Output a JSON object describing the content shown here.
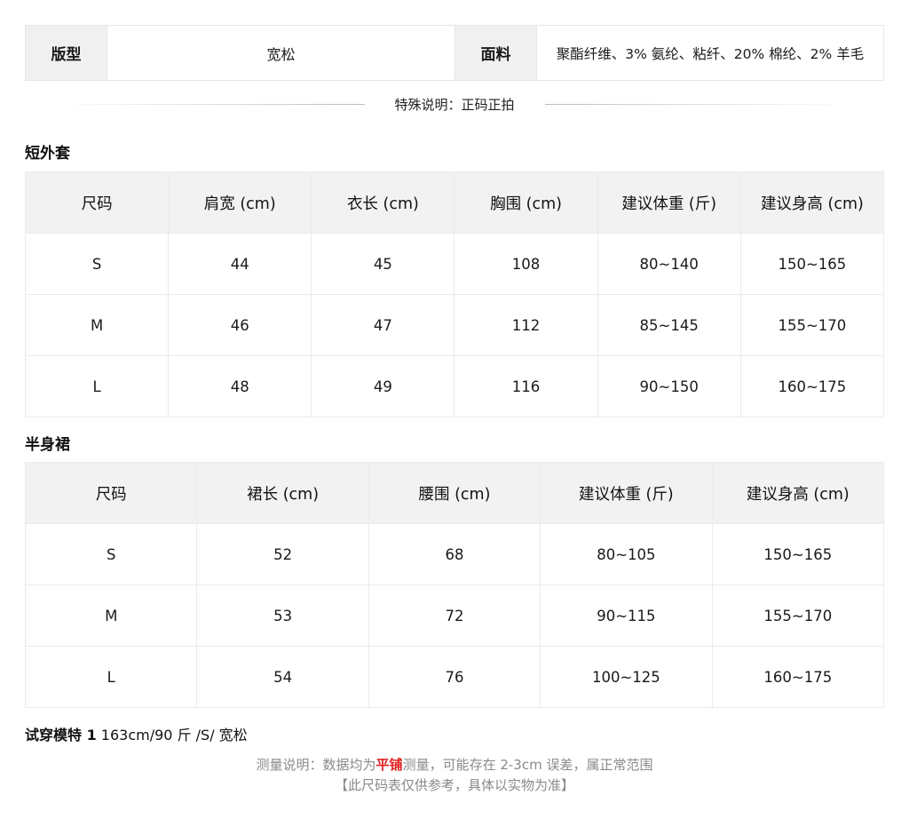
{
  "spec": {
    "style_label": "版型",
    "style_value": "宽松",
    "fabric_label": "面料",
    "fabric_value": "聚酯纤维、3% 氨纶、粘纤、20% 棉纶、2% 羊毛"
  },
  "special_note": "特殊说明：正码正拍",
  "jacket": {
    "title": "短外套",
    "headers": [
      "尺码",
      "肩宽 (cm)",
      "衣长 (cm)",
      "胸围 (cm)",
      "建议体重 (斤)",
      "建议身高 (cm)"
    ],
    "rows": [
      [
        "S",
        "44",
        "45",
        "108",
        "80~140",
        "150~165"
      ],
      [
        "M",
        "46",
        "47",
        "112",
        "85~145",
        "155~170"
      ],
      [
        "L",
        "48",
        "49",
        "116",
        "90~150",
        "160~175"
      ]
    ]
  },
  "skirt": {
    "title": "半身裙",
    "headers": [
      "尺码",
      "裙长 (cm)",
      "腰围 (cm)",
      "建议体重 (斤)",
      "建议身高 (cm)"
    ],
    "rows": [
      [
        "S",
        "52",
        "68",
        "80~105",
        "150~165"
      ],
      [
        "M",
        "53",
        "72",
        "90~115",
        "155~170"
      ],
      [
        "L",
        "54",
        "76",
        "100~125",
        "160~175"
      ]
    ]
  },
  "model": {
    "label": "试穿模特 1",
    "value": " 163cm/90 斤 /S/ 宽松"
  },
  "footer": {
    "line1_prefix": "测量说明：数据均为",
    "line1_highlight": "平铺",
    "line1_suffix": "测量，可能存在 2-3cm 误差，属正常范围",
    "line2": "【此尺码表仅供参考，具体以实物为准】"
  },
  "colors": {
    "highlight": "#e02020",
    "header_bg": "#f2f2f2"
  }
}
